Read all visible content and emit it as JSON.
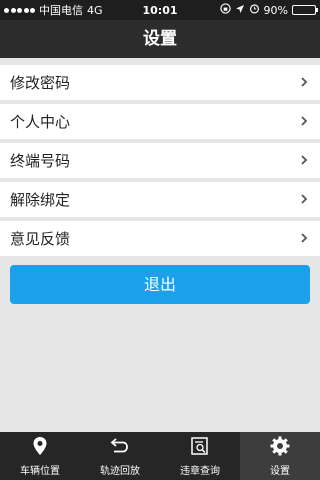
{
  "status": {
    "carrier": "中国电信",
    "network": "4G",
    "time": "10:01",
    "battery": "90%",
    "battery_level": 0.9,
    "battery_color": "#4cd964"
  },
  "header": {
    "title": "设置"
  },
  "menu": {
    "items": [
      {
        "label": "修改密码",
        "icon": "chevron-right-icon"
      },
      {
        "label": "个人中心",
        "icon": "chevron-right-icon"
      },
      {
        "label": "终端号码",
        "icon": "chevron-right-icon"
      },
      {
        "label": "解除绑定",
        "icon": "chevron-right-icon"
      },
      {
        "label": "意见反馈",
        "icon": "chevron-right-icon"
      }
    ]
  },
  "logout": {
    "label": "退出",
    "color": "#1aa1ea"
  },
  "tabbar": {
    "tabs": [
      {
        "label": "车辆位置",
        "icon": "location-pin-icon"
      },
      {
        "label": "轨迹回放",
        "icon": "replay-icon"
      },
      {
        "label": "违章查询",
        "icon": "violation-search-icon"
      },
      {
        "label": "设置",
        "icon": "gear-icon",
        "active": true
      }
    ]
  }
}
